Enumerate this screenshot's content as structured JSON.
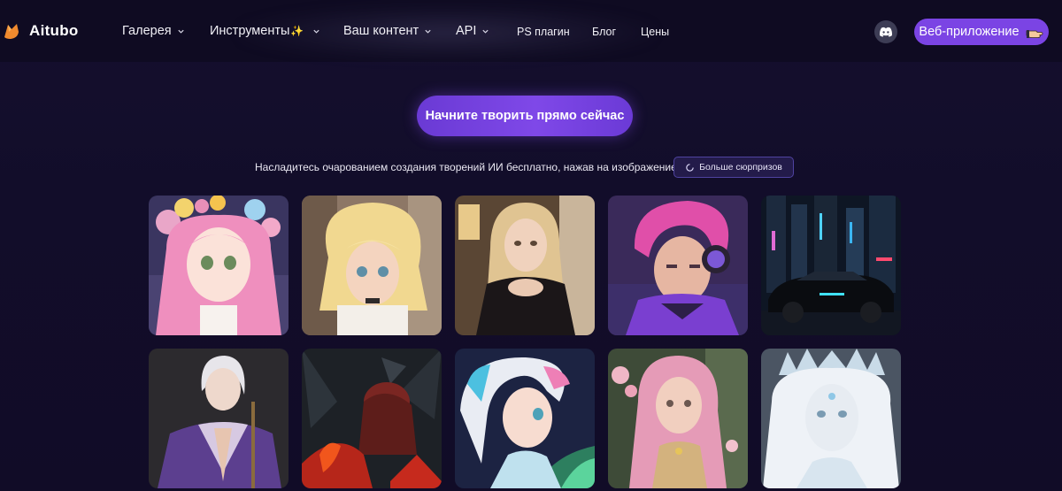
{
  "brand": {
    "name": "Aitubo",
    "logo_icon": "fox-logo-icon",
    "accent": "#7b44e4"
  },
  "nav": {
    "items": [
      {
        "label": "Галерея",
        "dropdown": true
      },
      {
        "label": "Инструменты",
        "dropdown": true,
        "sparkle": "✨"
      },
      {
        "label": "Ваш контент",
        "dropdown": true
      },
      {
        "label": "API",
        "dropdown": true
      },
      {
        "label": "PS плагин",
        "dropdown": false
      },
      {
        "label": "Блог",
        "dropdown": false
      },
      {
        "label": "Цены",
        "dropdown": false
      }
    ],
    "discord_icon": "discord-icon",
    "webapp_label": "Веб-приложение",
    "webapp_icon": "pointing-hand-icon"
  },
  "hero": {
    "cta_label": "Начните творить прямо сейчас",
    "tagline": "Насладитесь очарованием создания творений ИИ бесплатно, нажав на изображение.",
    "surprise_label": "Больше сюрпризов",
    "surprise_icon": "refresh-icon"
  },
  "gallery": {
    "images": [
      {
        "subject": "pink-haired anime girl with flower crown"
      },
      {
        "subject": "blonde anime girl in white blouse"
      },
      {
        "subject": "blonde woman in black dress"
      },
      {
        "subject": "pink-haired man with headphones"
      },
      {
        "subject": "black sports car in neon city"
      },
      {
        "subject": "white-haired man in purple robe"
      },
      {
        "subject": "dark red demon warrior"
      },
      {
        "subject": "white and pink haired anime girl under aurora"
      },
      {
        "subject": "pink-haired woman with flowers"
      },
      {
        "subject": "white-haired ice queen with crown"
      }
    ]
  }
}
